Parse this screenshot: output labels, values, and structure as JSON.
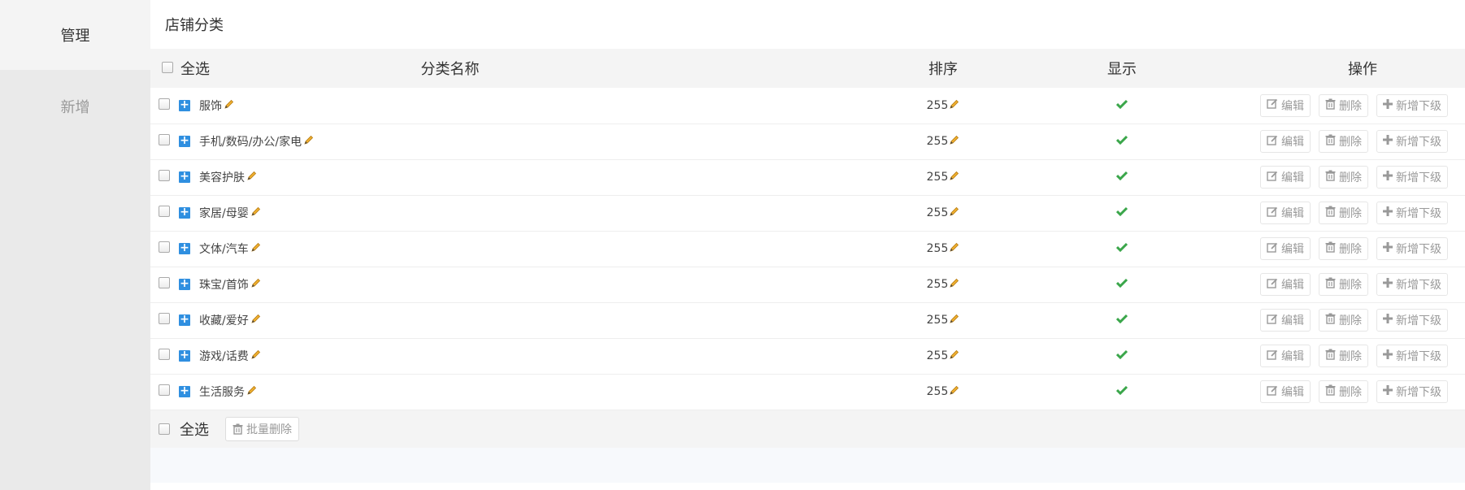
{
  "sidebar": {
    "items": [
      {
        "label": "管理",
        "active": true
      },
      {
        "label": "新增",
        "active": false
      }
    ]
  },
  "page": {
    "title": "店铺分类"
  },
  "table": {
    "headers": {
      "select_all": "全选",
      "name": "分类名称",
      "sort": "排序",
      "show": "显示",
      "ops": "操作"
    },
    "rows": [
      {
        "name": "服饰",
        "sort": "255",
        "visible": true
      },
      {
        "name": "手机/数码/办公/家电",
        "sort": "255",
        "visible": true
      },
      {
        "name": "美容护肤",
        "sort": "255",
        "visible": true
      },
      {
        "name": "家居/母婴",
        "sort": "255",
        "visible": true
      },
      {
        "name": "文体/汽车",
        "sort": "255",
        "visible": true
      },
      {
        "name": "珠宝/首饰",
        "sort": "255",
        "visible": true
      },
      {
        "name": "收藏/爱好",
        "sort": "255",
        "visible": true
      },
      {
        "name": "游戏/话费",
        "sort": "255",
        "visible": true
      },
      {
        "name": "生活服务",
        "sort": "255",
        "visible": true
      }
    ],
    "row_actions": {
      "edit": "编辑",
      "delete": "删除",
      "add_child": "新增下级"
    }
  },
  "footer": {
    "select_all": "全选",
    "batch_delete": "批量删除"
  },
  "colors": {
    "expand_icon": "#2f8fe0",
    "check_icon": "#3aa64a",
    "pencil": "#f0a020"
  }
}
